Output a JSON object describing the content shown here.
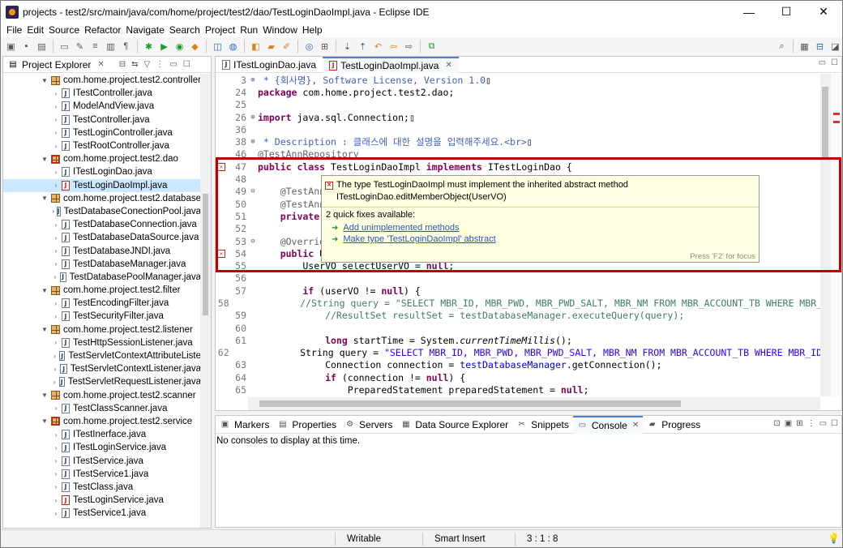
{
  "window": {
    "title": "projects - test2/src/main/java/com/home/project/test2/dao/TestLoginDaoImpl.java - Eclipse IDE",
    "controls": {
      "minimize": "—",
      "maximize": "☐",
      "close": "✕"
    }
  },
  "menu": [
    "File",
    "Edit",
    "Source",
    "Refactor",
    "Navigate",
    "Search",
    "Project",
    "Run",
    "Window",
    "Help"
  ],
  "explorer": {
    "title": "Project Explorer",
    "close": "✕",
    "items": [
      {
        "kind": "pkg",
        "label": "com.home.project.test2.controller",
        "error": false
      },
      {
        "kind": "file",
        "label": "ITestController.java",
        "error": false
      },
      {
        "kind": "file",
        "label": "ModelAndView.java",
        "error": false
      },
      {
        "kind": "file",
        "label": "TestController.java",
        "error": false
      },
      {
        "kind": "file",
        "label": "TestLoginController.java",
        "error": false
      },
      {
        "kind": "file",
        "label": "TestRootController.java",
        "error": false
      },
      {
        "kind": "pkg",
        "label": "com.home.project.test2.dao",
        "error": true
      },
      {
        "kind": "file",
        "label": "ITestLoginDao.java",
        "error": false
      },
      {
        "kind": "file",
        "label": "TestLoginDaoImpl.java",
        "error": true,
        "selected": true
      },
      {
        "kind": "pkg",
        "label": "com.home.project.test2.database",
        "error": false
      },
      {
        "kind": "file",
        "label": "TestDatabaseConectionPool.java",
        "error": false
      },
      {
        "kind": "file",
        "label": "TestDatabaseConnection.java",
        "error": false
      },
      {
        "kind": "file",
        "label": "TestDatabaseDataSource.java",
        "error": false
      },
      {
        "kind": "file",
        "label": "TestDatabaseJNDI.java",
        "error": false
      },
      {
        "kind": "file",
        "label": "TestDatabaseManager.java",
        "error": false
      },
      {
        "kind": "file",
        "label": "TestDatabasePoolManager.java",
        "error": false
      },
      {
        "kind": "pkg",
        "label": "com.home.project.test2.filter",
        "error": false
      },
      {
        "kind": "file",
        "label": "TestEncodingFilter.java",
        "error": false
      },
      {
        "kind": "file",
        "label": "TestSecurityFilter.java",
        "error": false
      },
      {
        "kind": "pkg",
        "label": "com.home.project.test2.listener",
        "error": false
      },
      {
        "kind": "file",
        "label": "TestHttpSessionListener.java",
        "error": false
      },
      {
        "kind": "file",
        "label": "TestServletContextAttributeListe",
        "error": false
      },
      {
        "kind": "file",
        "label": "TestServletContextListener.java",
        "error": false
      },
      {
        "kind": "file",
        "label": "TestServletRequestListener.java",
        "error": false
      },
      {
        "kind": "pkg",
        "label": "com.home.project.test2.scanner",
        "error": false
      },
      {
        "kind": "file",
        "label": "TestClassScanner.java",
        "error": false
      },
      {
        "kind": "pkg",
        "label": "com.home.project.test2.service",
        "error": true
      },
      {
        "kind": "file",
        "label": "ITestInerface.java",
        "error": false
      },
      {
        "kind": "file",
        "label": "ITestLoginService.java",
        "error": false
      },
      {
        "kind": "file",
        "label": "ITestService.java",
        "error": false
      },
      {
        "kind": "file",
        "label": "ITestService1.java",
        "error": false
      },
      {
        "kind": "file",
        "label": "TestClass.java",
        "error": false
      },
      {
        "kind": "file",
        "label": "TestLoginService.java",
        "error": true
      },
      {
        "kind": "file",
        "label": "TestService1.java",
        "error": false
      }
    ]
  },
  "editor": {
    "tabs": [
      {
        "label": "ITestLoginDao.java",
        "active": false
      },
      {
        "label": "TestLoginDaoImpl.java",
        "active": true,
        "close": "✕"
      }
    ],
    "lines": [
      {
        "num": "3",
        "fold": "⊕",
        "err": false,
        "segs": [
          {
            "c": "jd",
            "t": " * {회사명}, Software License, Version 1.0"
          },
          {
            "c": "",
            "t": "▯"
          }
        ]
      },
      {
        "num": "24",
        "fold": "",
        "err": false,
        "segs": [
          {
            "c": "kw",
            "t": "package"
          },
          {
            "c": "",
            "t": " com.home.project.test2.dao;"
          }
        ]
      },
      {
        "num": "25",
        "fold": "",
        "err": false,
        "segs": [
          {
            "c": "",
            "t": ""
          }
        ]
      },
      {
        "num": "26",
        "fold": "⊕",
        "err": false,
        "segs": [
          {
            "c": "kw",
            "t": "import"
          },
          {
            "c": "",
            "t": " java.sql.Connection;▯"
          }
        ]
      },
      {
        "num": "36",
        "fold": "",
        "err": false,
        "segs": [
          {
            "c": "",
            "t": ""
          }
        ]
      },
      {
        "num": "38",
        "fold": "⊕",
        "err": false,
        "segs": [
          {
            "c": "jd",
            "t": " * Description : 클래스에 대한 설명을 입력해주세요.<br>"
          },
          {
            "c": "",
            "t": "▯"
          }
        ]
      },
      {
        "num": "46",
        "fold": "",
        "err": false,
        "segs": [
          {
            "c": "ann",
            "t": "@TestAnnRepository"
          }
        ]
      },
      {
        "num": "47",
        "fold": "",
        "err": true,
        "segs": [
          {
            "c": "kw",
            "t": "public class"
          },
          {
            "c": "",
            "t": " TestLoginDaoImpl "
          },
          {
            "c": "kw",
            "t": "implements"
          },
          {
            "c": "",
            "t": " ITestLoginDao {"
          }
        ]
      },
      {
        "num": "48",
        "fold": "",
        "err": false,
        "segs": [
          {
            "c": "",
            "t": ""
          }
        ]
      },
      {
        "num": "49",
        "fold": "⊖",
        "err": false,
        "segs": [
          {
            "c": "ann",
            "t": "    @TestAnnA"
          }
        ]
      },
      {
        "num": "50",
        "fold": "",
        "err": false,
        "segs": [
          {
            "c": "ann",
            "t": "    @TestAnnQ"
          }
        ]
      },
      {
        "num": "51",
        "fold": "",
        "err": false,
        "segs": [
          {
            "c": "kw",
            "t": "    private"
          },
          {
            "c": "",
            "t": " T"
          }
        ]
      },
      {
        "num": "52",
        "fold": "",
        "err": false,
        "segs": [
          {
            "c": "",
            "t": ""
          }
        ]
      },
      {
        "num": "53",
        "fold": "⊖",
        "err": false,
        "segs": [
          {
            "c": "ann",
            "t": "    @Override"
          }
        ]
      },
      {
        "num": "54",
        "fold": "",
        "err": true,
        "segs": [
          {
            "c": "kw",
            "t": "    public"
          },
          {
            "c": "",
            "t": " Us"
          }
        ]
      },
      {
        "num": "55",
        "fold": "",
        "err": false,
        "segs": [
          {
            "c": "",
            "t": "        UserVO "
          },
          {
            "c": "",
            "t": "selectUserVO = "
          },
          {
            "c": "kw",
            "t": "null"
          },
          {
            "c": "",
            "t": ";"
          }
        ]
      },
      {
        "num": "56",
        "fold": "",
        "err": false,
        "segs": [
          {
            "c": "",
            "t": ""
          }
        ]
      },
      {
        "num": "57",
        "fold": "",
        "err": false,
        "segs": [
          {
            "c": "kw",
            "t": "        if"
          },
          {
            "c": "",
            "t": " (userVO != "
          },
          {
            "c": "kw",
            "t": "null"
          },
          {
            "c": "",
            "t": ") {"
          }
        ]
      },
      {
        "num": "58",
        "fold": "",
        "err": false,
        "segs": [
          {
            "c": "cm",
            "t": "            //String query = \"SELECT MBR_ID, MBR_PWD, MBR_PWD_SALT, MBR_NM FROM MBR_ACCOUNT_TB WHERE MBR_"
          }
        ]
      },
      {
        "num": "59",
        "fold": "",
        "err": false,
        "segs": [
          {
            "c": "cm",
            "t": "            //ResultSet resultSet = testDatabaseManager.executeQuery(query);"
          }
        ]
      },
      {
        "num": "60",
        "fold": "",
        "err": false,
        "segs": [
          {
            "c": "",
            "t": ""
          }
        ]
      },
      {
        "num": "61",
        "fold": "",
        "err": false,
        "segs": [
          {
            "c": "kw",
            "t": "            long"
          },
          {
            "c": "",
            "t": " startTime = System."
          },
          {
            "c": "itl",
            "t": "currentTimeMillis"
          },
          {
            "c": "",
            "t": "();"
          }
        ]
      },
      {
        "num": "62",
        "fold": "",
        "err": false,
        "segs": [
          {
            "c": "",
            "t": "            String "
          },
          {
            "c": "",
            "t": "query = "
          },
          {
            "c": "str",
            "t": "\"SELECT MBR_ID, MBR_PWD, MBR_PWD_SALT, MBR_NM FROM MBR_ACCOUNT_TB WHERE MBR_ID"
          }
        ]
      },
      {
        "num": "63",
        "fold": "",
        "err": false,
        "segs": [
          {
            "c": "",
            "t": "            Connection "
          },
          {
            "c": "",
            "t": "connection = "
          },
          {
            "c": "fld",
            "t": "testDatabaseManager"
          },
          {
            "c": "",
            "t": ".getConnection();"
          }
        ]
      },
      {
        "num": "64",
        "fold": "",
        "err": false,
        "segs": [
          {
            "c": "kw",
            "t": "            if"
          },
          {
            "c": "",
            "t": " (connection != "
          },
          {
            "c": "kw",
            "t": "null"
          },
          {
            "c": "",
            "t": ") {"
          }
        ]
      },
      {
        "num": "65",
        "fold": "",
        "err": false,
        "segs": [
          {
            "c": "",
            "t": "                PreparedStatement preparedStatement = "
          },
          {
            "c": "kw",
            "t": "null"
          },
          {
            "c": "",
            "t": ";"
          }
        ]
      }
    ]
  },
  "popup": {
    "message_line1": "The type TestLoginDaoImpl must implement the inherited abstract method",
    "message_line2": "ITestLoginDao.editMemberObject(UserVO)",
    "fix_count": "2 quick fixes available:",
    "fixes": [
      "Add unimplemented methods",
      "Make type 'TestLoginDaoImpl' abstract"
    ],
    "focus_hint": "Press 'F2' for focus"
  },
  "bottom": {
    "tabs": [
      {
        "label": "Markers",
        "icon": "markers-icon",
        "active": false
      },
      {
        "label": "Properties",
        "icon": "properties-icon",
        "active": false
      },
      {
        "label": "Servers",
        "icon": "servers-icon",
        "active": false
      },
      {
        "label": "Data Source Explorer",
        "icon": "data-source-icon",
        "active": false
      },
      {
        "label": "Snippets",
        "icon": "snippets-icon",
        "active": false
      },
      {
        "label": "Console",
        "icon": "console-icon",
        "active": true
      },
      {
        "label": "Progress",
        "icon": "progress-icon",
        "active": false
      }
    ],
    "message": "No consoles to display at this time."
  },
  "status": {
    "mode": "Writable",
    "insert": "Smart Insert",
    "position": "3 : 1 : 8"
  }
}
